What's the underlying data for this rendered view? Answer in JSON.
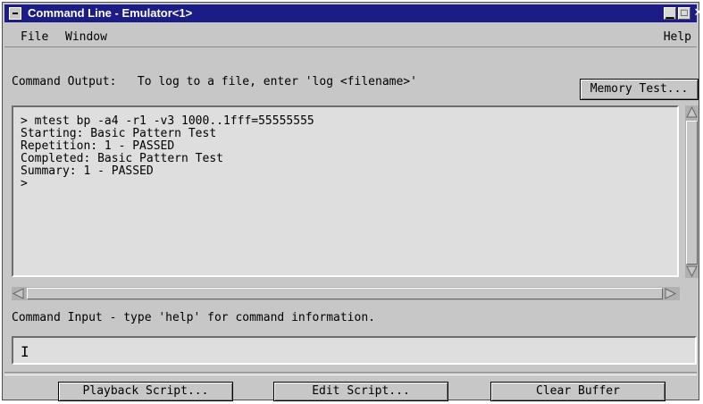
{
  "window": {
    "title": "Command Line - Emulator<1>"
  },
  "menu": {
    "file": "File",
    "window": "Window",
    "help": "Help"
  },
  "output_section": {
    "label": "Command Output:   To log to a file, enter 'log <filename>'",
    "memory_test_button": "Memory Test...",
    "lines": [
      "> mtest bp -a4 -r1 -v3 1000..1fff=55555555",
      "Starting: Basic Pattern Test",
      "Repetition: 1 - PASSED",
      "Completed: Basic Pattern Test",
      "Summary: 1 - PASSED",
      ">"
    ]
  },
  "input_section": {
    "label": "Command Input - type 'help' for command information.",
    "value": ""
  },
  "buttons": {
    "playback": "Playback Script...",
    "edit": "Edit Script...",
    "clear": "Clear Buffer"
  }
}
